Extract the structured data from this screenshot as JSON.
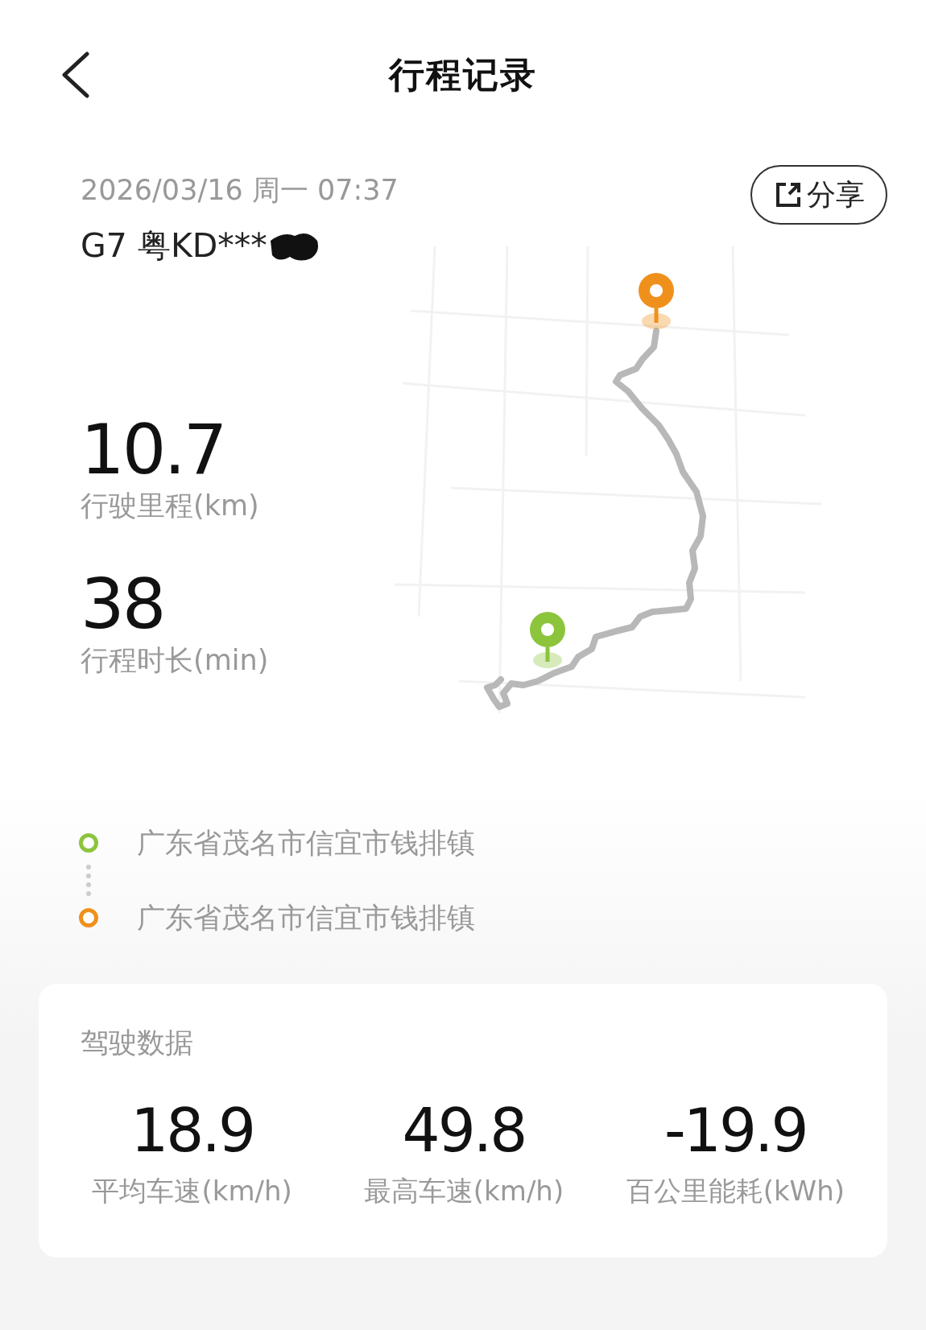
{
  "header": {
    "title": "行程记录"
  },
  "trip": {
    "datetime": "2026/03/16 周一 07:37",
    "vehicle": "G7 粤KD***",
    "share_label": "分享"
  },
  "metrics": [
    {
      "value": "10.7",
      "label": "行驶里程(km)"
    },
    {
      "value": "38",
      "label": "行程时长(min)"
    }
  ],
  "route": [
    {
      "kind": "start",
      "address": "广东省茂名市信宜市钱排镇",
      "color": "#8cc43c"
    },
    {
      "kind": "end",
      "address": "广东省茂名市信宜市钱排镇",
      "color": "#f0901c"
    }
  ],
  "driving_data": {
    "title": "驾驶数据",
    "stats": [
      {
        "value": "18.9",
        "label": "平均车速(km/h)"
      },
      {
        "value": "49.8",
        "label": "最高车速(km/h)"
      },
      {
        "value": "-19.9",
        "label": "百公里能耗(kWh)"
      }
    ]
  }
}
